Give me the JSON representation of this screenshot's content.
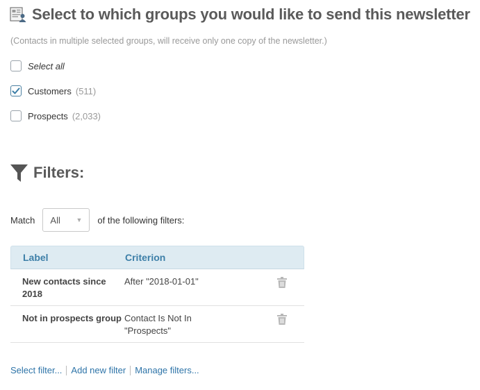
{
  "header": {
    "title": "Select to which groups you would like to send this newsletter",
    "icon": "newsletter-icon",
    "note": "(Contacts in multiple selected groups, will receive only one copy of the newsletter.)"
  },
  "groups": {
    "select_all": {
      "label": "Select all",
      "checked": false
    },
    "items": [
      {
        "label": "Customers",
        "count": "(511)",
        "checked": true
      },
      {
        "label": "Prospects",
        "count": "(2,033)",
        "checked": false
      }
    ]
  },
  "filters": {
    "heading": "Filters:",
    "icon": "funnel-icon",
    "match_prefix": "Match",
    "match_value": "All",
    "match_suffix": "of the following filters:",
    "columns": [
      "Label",
      "Criterion"
    ],
    "rows": [
      {
        "label": "New contacts since 2018",
        "criterion": "After \"2018-01-01\""
      },
      {
        "label": "Not in prospects group",
        "criterion": "Contact Is Not In \"Prospects\""
      }
    ]
  },
  "links": {
    "select_filter": "Select filter...",
    "add_new_filter": "Add new filter",
    "manage_filters": "Manage filters..."
  },
  "colors": {
    "accent": "#3d7fa8",
    "header_bg": "#deebf2",
    "link": "#2e74a8"
  }
}
